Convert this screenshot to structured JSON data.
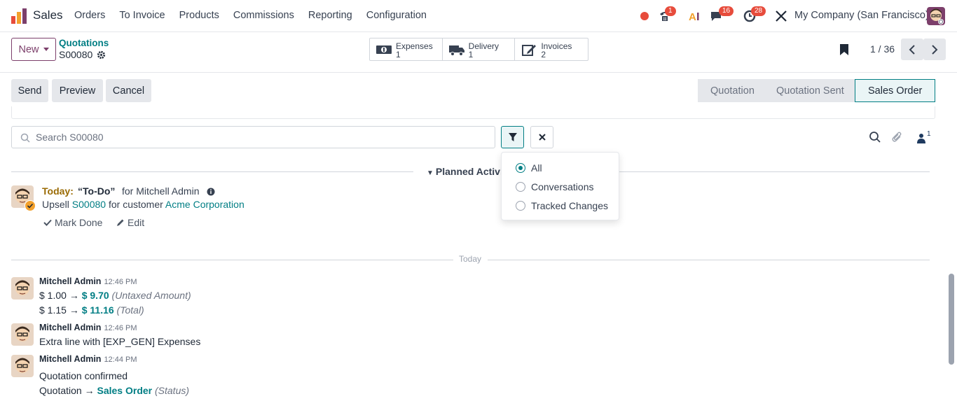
{
  "navbar": {
    "app_name": "Sales",
    "menu": [
      "Orders",
      "To Invoice",
      "Products",
      "Commissions",
      "Reporting",
      "Configuration"
    ],
    "badges": {
      "calls": "1",
      "messages": "16",
      "activities": "28"
    },
    "company": "My Company (San Francisco)"
  },
  "control": {
    "new_label": "New",
    "breadcrumb_parent": "Quotations",
    "record": "S00080",
    "smart_buttons": [
      {
        "label": "Expenses",
        "count": "1",
        "icon": "money-icon"
      },
      {
        "label": "Delivery",
        "count": "1",
        "icon": "truck-icon"
      },
      {
        "label": "Invoices",
        "count": "2",
        "icon": "pencil-square-icon"
      }
    ],
    "pager": "1 / 36"
  },
  "actions": {
    "send": "Send",
    "preview": "Preview",
    "cancel": "Cancel",
    "stages": [
      "Quotation",
      "Quotation Sent",
      "Sales Order"
    ],
    "active_stage": "Sales Order"
  },
  "chatter": {
    "search_placeholder": "Search S00080",
    "followers_count": "1",
    "filter_options": [
      "All",
      "Conversations",
      "Tracked Changes"
    ],
    "selected_filter": "All",
    "planned_label": "Planned Activities",
    "activity": {
      "today": "Today:",
      "summary": "“To-Do”",
      "for_user": "for Mitchell Admin",
      "line_prefix": "Upsell",
      "order_ref": "S00080",
      "line_mid": "for customer",
      "customer": "Acme Corporation",
      "mark_done": "Mark Done",
      "edit": "Edit"
    },
    "date_separator": "Today",
    "messages": [
      {
        "author": "Mitchell Admin",
        "time": "12:46 PM",
        "lines": [
          {
            "old": "$ 1.00",
            "new": "$ 9.70",
            "field": "(Untaxed Amount)"
          },
          {
            "old": "$ 1.15",
            "new": "$ 11.16",
            "field": "(Total)"
          }
        ]
      },
      {
        "author": "Mitchell Admin",
        "time": "12:46 PM",
        "text": "Extra line with [EXP_GEN] Expenses"
      },
      {
        "author": "Mitchell Admin",
        "time": "12:44 PM",
        "text": "Quotation confirmed",
        "lines": [
          {
            "old": "Quotation",
            "new": "Sales Order",
            "field": "(Status)"
          }
        ]
      }
    ]
  },
  "colors": {
    "brand": "#7c3f6b",
    "accent": "#017e84",
    "badge": "#e74c3c"
  }
}
